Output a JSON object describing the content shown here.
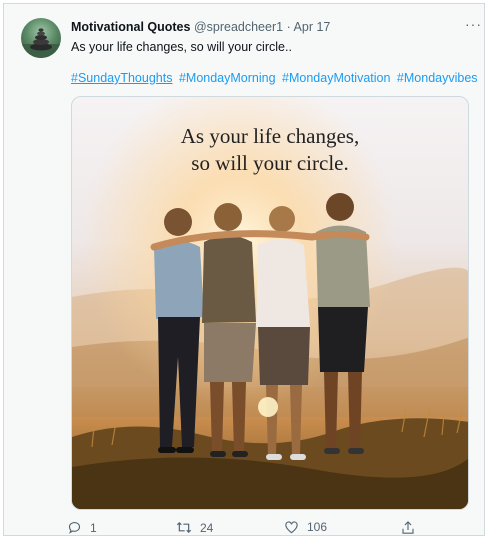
{
  "tweet": {
    "display_name": "Motivational Quotes",
    "handle": "@spreadcheer1",
    "separator": "·",
    "date": "Apr 17",
    "more_label": "···",
    "text": "As your life changes, so will your circle..",
    "hashtags": [
      "#SundayThoughts",
      "#MondayMorning",
      "#MondayMotivation",
      "#Mondayvibes"
    ]
  },
  "media": {
    "quote_line1": "As your life changes,",
    "quote_line2": "so will your circle.",
    "icon": "friends-sunset-image"
  },
  "actions": {
    "reply_count": "1",
    "retweet_count": "24",
    "like_count": "106",
    "icons": [
      "reply-icon",
      "retweet-icon",
      "like-icon",
      "share-icon"
    ]
  },
  "colors": {
    "link": "#1d9bf0",
    "secondary_text": "#536471",
    "border": "#cfd9de"
  }
}
